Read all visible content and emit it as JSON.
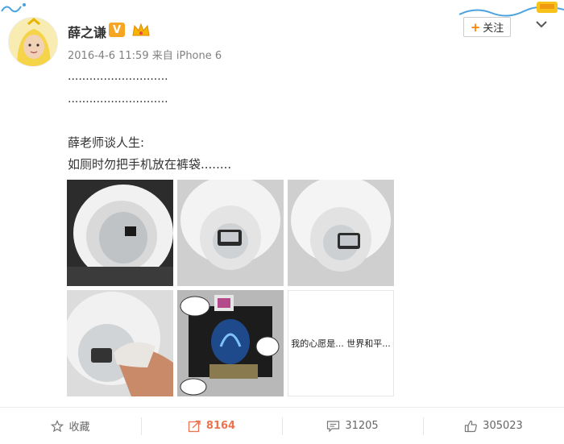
{
  "post": {
    "author": "薛之谦",
    "verified_badge": "V",
    "timestamp": "2016-4-6 11:59",
    "source_prefix": "来自",
    "source": "iPhone 6",
    "meta_text": "2016-4-6 11:59 来自 iPhone 6",
    "follow_label": "关注",
    "text_lines": [
      "............................",
      "............................",
      "薛老师谈人生:",
      "如厕时勿把手机放在裤袋........"
    ],
    "last_image_caption": "我的心愿是... 世界和平..."
  },
  "actions": {
    "favorite_label": "收藏",
    "repost_count": "8164",
    "comment_count": "31205",
    "like_count": "305023"
  },
  "colors": {
    "accent_orange": "#ff8200",
    "repost_highlight": "#eb7350",
    "verified_badge": "#f6a623"
  }
}
